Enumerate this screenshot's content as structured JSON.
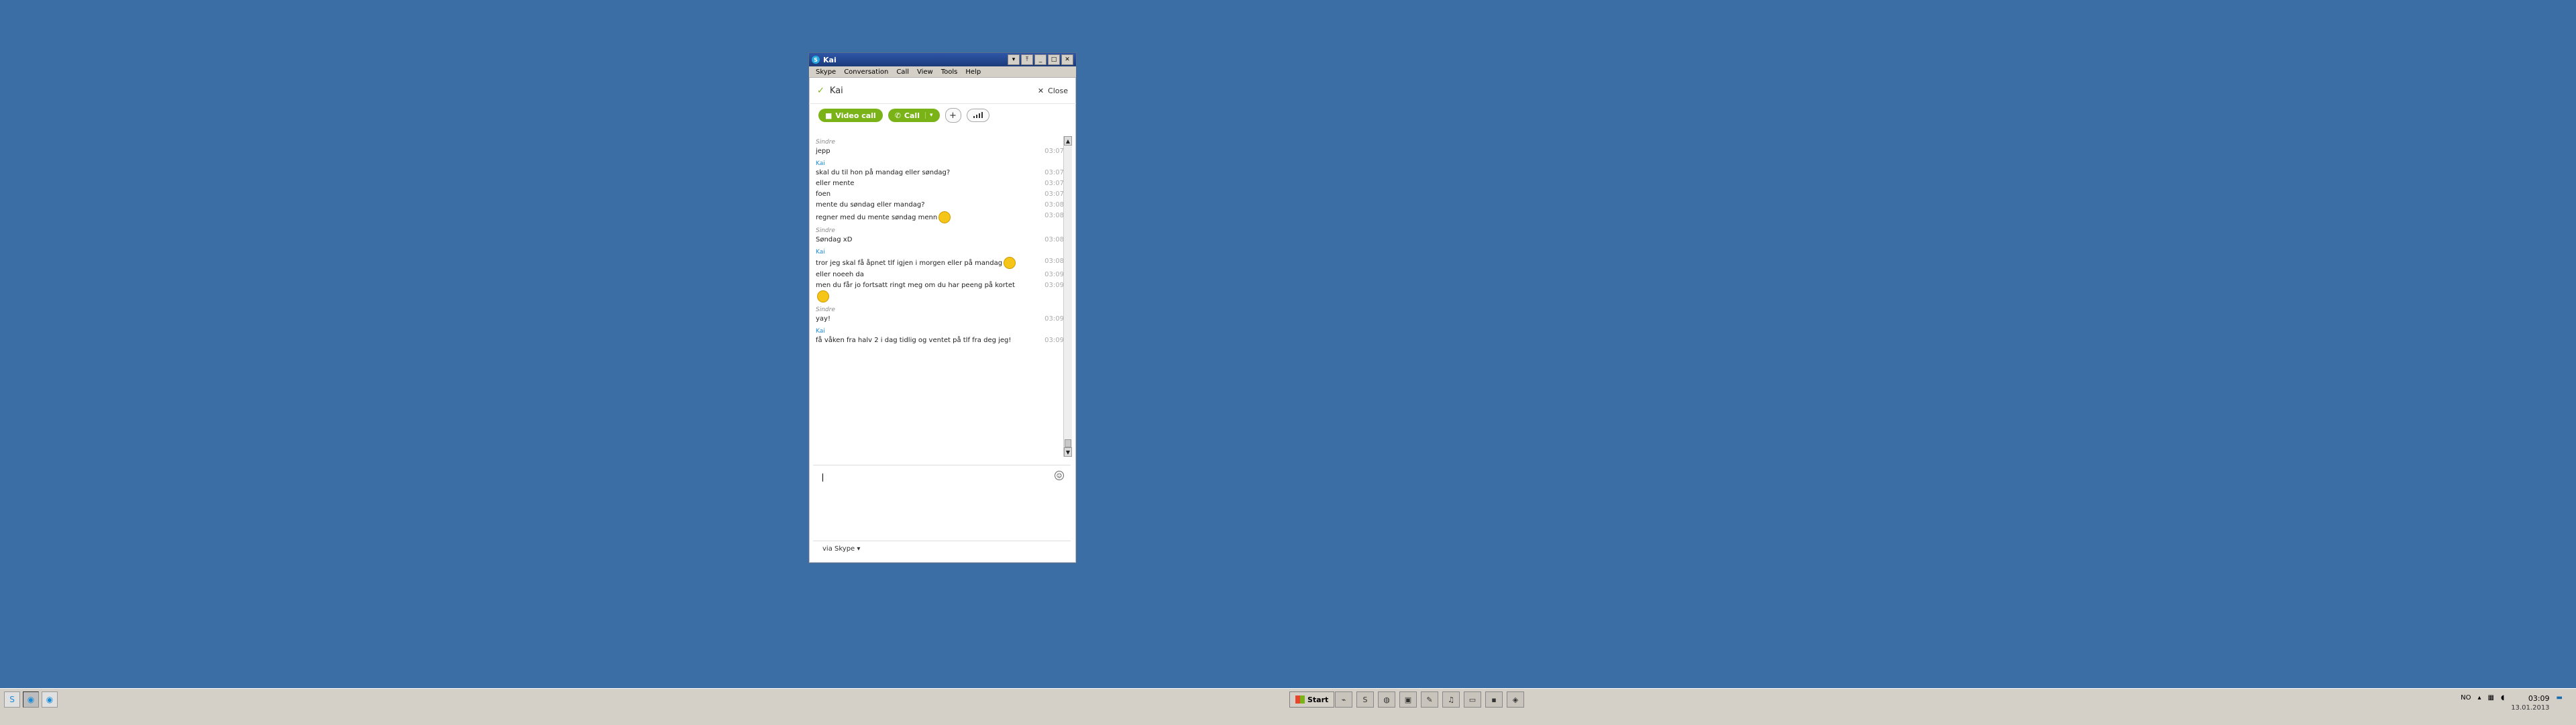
{
  "window": {
    "title": "Kai",
    "buttons": [
      "▾",
      "⤒",
      "_",
      "□",
      "✕"
    ],
    "menus": [
      "Skype",
      "Conversation",
      "Call",
      "View",
      "Tools",
      "Help"
    ],
    "contact_name": "Kai",
    "close_label": "Close",
    "video_call_label": "Video call",
    "call_label": "Call",
    "via_label": "via Skype"
  },
  "chat": {
    "messages": [
      {
        "sender": "Sindre",
        "text": "jepp",
        "time": "03:07"
      },
      {
        "sender": "Kai",
        "text": "skal du til hon på mandag eller søndag?",
        "time": "03:07"
      },
      {
        "sender": "",
        "text": "eller mente",
        "time": "03:07"
      },
      {
        "sender": "",
        "text": "foen",
        "time": "03:07"
      },
      {
        "sender": "",
        "text": "mente du søndag eller mandag?",
        "time": "03:08"
      },
      {
        "sender": "",
        "text": "regner med du mente søndag menn",
        "time": "03:08",
        "emoji": true
      },
      {
        "sender": "Sindre",
        "text": "Søndag xD",
        "time": "03:08"
      },
      {
        "sender": "Kai",
        "text": "tror jeg skal få åpnet tlf igjen i morgen eller på mandag",
        "time": "03:08",
        "emoji": true
      },
      {
        "sender": "",
        "text": "eller noeeh da",
        "time": "03:09"
      },
      {
        "sender": "",
        "text": "men du får jo fortsatt ringt meg om du har peeng på kortet",
        "time": "03:09",
        "emoji": true
      },
      {
        "sender": "Sindre",
        "text": "yay!",
        "time": "03:09"
      },
      {
        "sender": "Kai",
        "text": "få våken fra halv 2 i dag tidlig og ventet på tlf fra deg jeg!",
        "time": "03:09"
      }
    ]
  },
  "taskbar": {
    "start_label": "Start",
    "language": "NO",
    "clock_time": "03:09",
    "clock_date": "13.01.2013"
  },
  "colors": {
    "desktop": "#3a6ea5",
    "skype_green": "#7ab317",
    "kai_blue": "#1a8cd8"
  }
}
